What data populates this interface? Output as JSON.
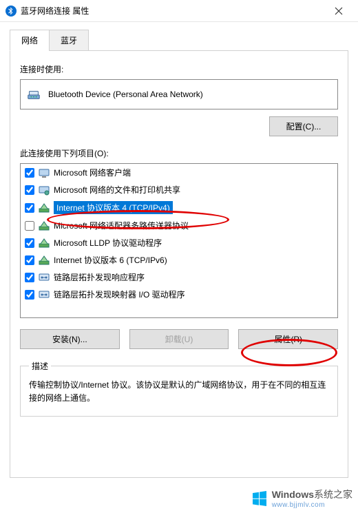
{
  "titlebar": {
    "title": "蓝牙网络连接 属性"
  },
  "tabs": {
    "network": "网络",
    "bluetooth": "蓝牙"
  },
  "connect_label": "连接时使用:",
  "device_name": "Bluetooth Device (Personal Area Network)",
  "configure_btn": "配置(C)...",
  "items_label": "此连接使用下列项目(O):",
  "items": [
    {
      "checked": true,
      "label": "Microsoft 网络客户端",
      "selected": false,
      "icon": "client"
    },
    {
      "checked": true,
      "label": "Microsoft 网络的文件和打印机共享",
      "selected": false,
      "icon": "share"
    },
    {
      "checked": true,
      "label": "Internet 协议版本 4 (TCP/IPv4)",
      "selected": true,
      "icon": "proto"
    },
    {
      "checked": false,
      "label": "Microsoft 网络适配器多路传送器协议",
      "selected": false,
      "icon": "proto"
    },
    {
      "checked": true,
      "label": "Microsoft LLDP 协议驱动程序",
      "selected": false,
      "icon": "proto"
    },
    {
      "checked": true,
      "label": "Internet 协议版本 6 (TCP/IPv6)",
      "selected": false,
      "icon": "proto"
    },
    {
      "checked": true,
      "label": "链路层拓扑发现响应程序",
      "selected": false,
      "icon": "lltd"
    },
    {
      "checked": true,
      "label": "链路层拓扑发现映射器 I/O 驱动程序",
      "selected": false,
      "icon": "lltd"
    }
  ],
  "buttons": {
    "install": "安装(N)...",
    "uninstall": "卸载(U)",
    "properties": "属性(R)"
  },
  "desc": {
    "legend": "描述",
    "text": "传输控制协议/Internet 协议。该协议是默认的广域网络协议，用于在不同的相互连接的网络上通信。"
  },
  "watermark": {
    "brand": "Windows",
    "suffix": "系统之家",
    "url": "www.bjjmlv.com"
  }
}
